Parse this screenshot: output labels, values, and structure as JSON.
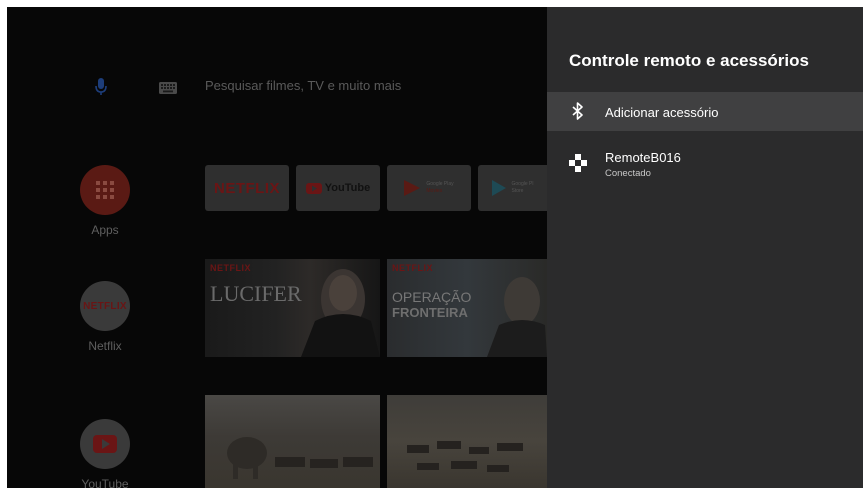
{
  "search": {
    "placeholder": "Pesquisar filmes, TV e muito mais",
    "icons": [
      "microphone-icon",
      "keyboard-icon"
    ]
  },
  "rail": {
    "apps_label": "Apps",
    "netflix_label": "Netflix",
    "netflix_logo": "NETFLIX",
    "youtube_label": "YouTube"
  },
  "tiles": {
    "netflix": "NETFLIX",
    "youtube": "YouTube",
    "google_play_movies_line1": "Google Play",
    "google_play_movies_line2": "Movies",
    "google_play_store_line1": "Google Pl",
    "google_play_store_line2": "Store"
  },
  "promos": {
    "lucifer_brand": "NETFLIX",
    "lucifer_title": "LUCIFER",
    "operacao_brand": "NETFLIX",
    "operacao_title_line1": "OPERAÇÃO",
    "operacao_title_line2": "FRONTEIRA"
  },
  "panel": {
    "title": "Controle remoto e acessórios",
    "items": [
      {
        "label": "Adicionar acessório",
        "icon": "bluetooth-icon",
        "selected": true
      },
      {
        "label": "RemoteB016",
        "sublabel": "Conectado",
        "icon": "gamepad-icon",
        "selected": false
      }
    ]
  },
  "colors": {
    "panel_bg": "#2b2b2c",
    "panel_selected": "#404041",
    "netflix_red": "#5a1414",
    "screen_bg": "#070707"
  }
}
